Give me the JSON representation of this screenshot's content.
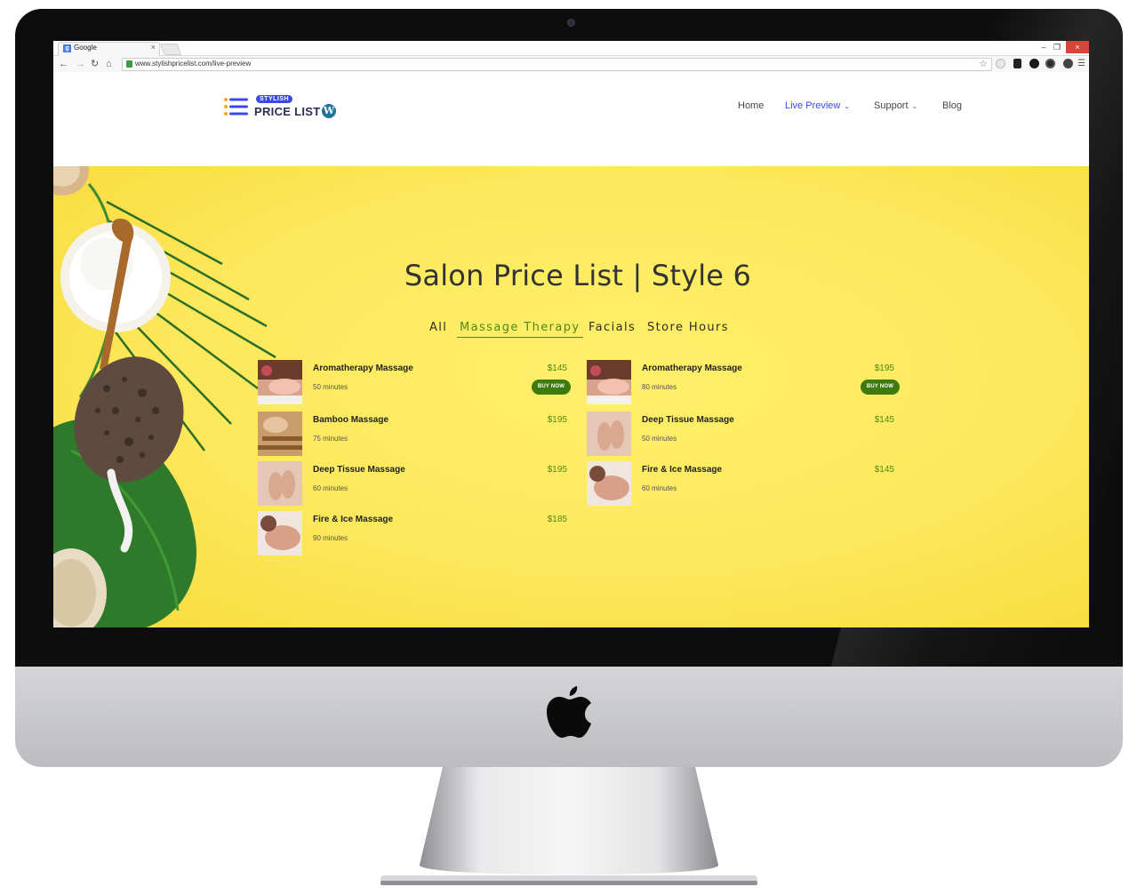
{
  "browser": {
    "tab_title": "Google",
    "tab_favicon": "g",
    "tab_close": "×",
    "window_min": "–",
    "window_max": "❐",
    "window_close": "×",
    "url": "www.stylishpricelist.com/live-preview",
    "nav_icons": [
      "back-arrow-icon",
      "forward-arrow-icon",
      "reload-icon",
      "home-icon"
    ]
  },
  "site": {
    "logo_badge": "STYLISH",
    "logo_text": "PRICE LIST",
    "logo_wp": "W",
    "menu": [
      {
        "label": "Home",
        "dropdown": false,
        "active": false
      },
      {
        "label": "Live Preview",
        "dropdown": true,
        "active": true
      },
      {
        "label": "Support",
        "dropdown": true,
        "active": false
      },
      {
        "label": "Blog",
        "dropdown": false,
        "active": false
      }
    ],
    "dropdown_glyph": "⌄"
  },
  "hero": {
    "title": "Salon Price List | Style 6",
    "filters": [
      "All",
      "Massage Therapy",
      "Facials",
      "Store Hours"
    ],
    "active_filter": "Massage Therapy",
    "buy_label": "BUY NOW",
    "items_left": [
      {
        "name": "Aromatherapy Massage",
        "duration": "50 minutes",
        "price": "$145",
        "buy": true
      },
      {
        "name": "Bamboo Massage",
        "duration": "75 minutes",
        "price": "$195",
        "buy": false
      },
      {
        "name": "Deep Tissue Massage",
        "duration": "60 minutes",
        "price": "$195",
        "buy": false
      },
      {
        "name": "Fire & Ice Massage",
        "duration": "90 minutes",
        "price": "$185",
        "buy": false
      }
    ],
    "items_right": [
      {
        "name": "Aromatherapy Massage",
        "duration": "80 minutes",
        "price": "$195",
        "buy": true
      },
      {
        "name": "Deep Tissue Massage",
        "duration": "50 minutes",
        "price": "$145",
        "buy": false
      },
      {
        "name": "Fire & Ice Massage",
        "duration": "60 minutes",
        "price": "$145",
        "buy": false
      }
    ]
  },
  "colors": {
    "accent_blue": "#3a48e8",
    "price_green": "#4f8a14",
    "button_green": "#3e7a0e",
    "hero_yellow": "#fce85c"
  }
}
